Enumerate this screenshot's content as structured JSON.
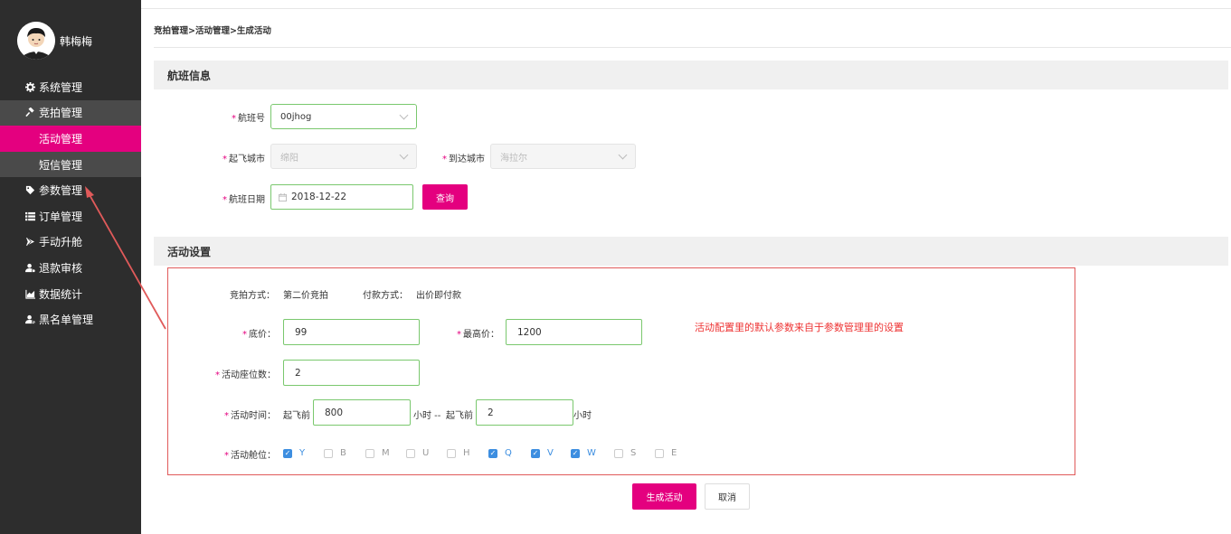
{
  "user": {
    "name": "韩梅梅"
  },
  "menu": [
    {
      "label": "系统管理",
      "icon": "gear-icon"
    },
    {
      "label": "竞拍管理",
      "icon": "gavel-icon"
    },
    {
      "label": "活动管理"
    },
    {
      "label": "短信管理"
    },
    {
      "label": "参数管理",
      "icon": "tag-icon"
    },
    {
      "label": "订单管理",
      "icon": "list-icon"
    },
    {
      "label": "手动升舱",
      "icon": "plane-icon"
    },
    {
      "label": "退款审核",
      "icon": "user-refund-icon"
    },
    {
      "label": "数据统计",
      "icon": "chart-icon"
    },
    {
      "label": "黑名单管理",
      "icon": "user-block-icon"
    }
  ],
  "breadcrumb": "竞拍管理>活动管理>生成活动",
  "flight_section": {
    "title": "航班信息",
    "flight_no_label": "航班号",
    "flight_no_value": "00jhog",
    "from_label": "起飞城市",
    "from_value": "绵阳",
    "to_label": "到达城市",
    "to_value": "海拉尔",
    "date_label": "航班日期",
    "date_value": "2018-12-22",
    "query_button": "查询"
  },
  "activity_section": {
    "title": "活动设置",
    "auction_label": "竞拍方式：",
    "auction_value": "第二价竞拍",
    "pay_label": "付款方式：",
    "pay_value": "出价即付款",
    "floor_label": "底价：",
    "floor_value": "99",
    "max_label": "最高价：",
    "max_value": "1200",
    "seats_label": "活动座位数：",
    "seats_value": "2",
    "time_label": "活动时间：",
    "before_takeoff_1": "起飞前",
    "time_start_value": "800",
    "hours_separator": "小时 --",
    "before_takeoff_2": "起飞前",
    "time_end_value": "2",
    "hours_suffix": "小时",
    "cabin_label": "活动舱位：",
    "cabins": [
      {
        "code": "Y",
        "checked": true
      },
      {
        "code": "B",
        "checked": false
      },
      {
        "code": "M",
        "checked": false
      },
      {
        "code": "U",
        "checked": false
      },
      {
        "code": "H",
        "checked": false
      },
      {
        "code": "Q",
        "checked": true
      },
      {
        "code": "V",
        "checked": true
      },
      {
        "code": "W",
        "checked": true
      },
      {
        "code": "S",
        "checked": false
      },
      {
        "code": "E",
        "checked": false
      }
    ],
    "annotation": "活动配置里的默认参数来自于参数管理里的设置"
  },
  "actions": {
    "generate": "生成活动",
    "cancel": "取消"
  },
  "colors": {
    "accent": "#e4007f",
    "sidebar": "#2d2d2d",
    "annotation": "#e05a5a",
    "input_border": "#7ac86e",
    "checkbox": "#3d8ee0"
  }
}
